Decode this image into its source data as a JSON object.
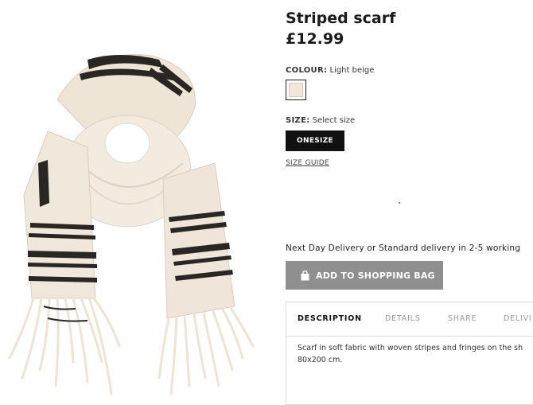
{
  "product": {
    "title": "Striped scarf",
    "price": "£12.99"
  },
  "colour": {
    "label": "COLOUR:",
    "value": "Light beige",
    "swatch_color": "#f1e6d9"
  },
  "size": {
    "label": "SIZE:",
    "value": "Select size",
    "option": "ONESIZE",
    "guide_link": "SIZE GUIDE"
  },
  "delivery": {
    "text": "Next Day Delivery or Standard delivery in 2-5 working"
  },
  "cart": {
    "add_label": "ADD TO SHOPPING BAG",
    "icon": "shopping-bag-icon"
  },
  "tabs": [
    {
      "label": "DESCRIPTION"
    },
    {
      "label": "DETAILS"
    },
    {
      "label": "SHARE"
    },
    {
      "label": "DELIVI"
    }
  ],
  "description": {
    "text": "Scarf in soft fabric with woven stripes and fringes on the sh 80x200 cm."
  },
  "colors": {
    "scarf_base": "#f1e8dc",
    "stripe": "#2a2623",
    "button_grey": "#8f8f8f",
    "size_button": "#111111"
  }
}
